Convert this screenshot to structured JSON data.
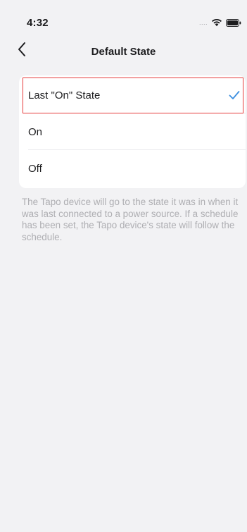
{
  "status_bar": {
    "time": "4:32",
    "signal_dots": "....",
    "icons": [
      "wifi-icon",
      "battery-icon"
    ]
  },
  "nav": {
    "back_icon": "chevron-left-icon",
    "title": "Default State"
  },
  "options": [
    {
      "label": "Last \"On\" State",
      "selected": true
    },
    {
      "label": "On",
      "selected": false
    },
    {
      "label": "Off",
      "selected": false
    }
  ],
  "description": "The Tapo device will go to the state it was in when it was last connected to a power source. If a schedule has been set, the Tapo device's state will follow the schedule.",
  "colors": {
    "background": "#f2f2f4",
    "card": "#ffffff",
    "accent_check": "#3d8fe0",
    "highlight_outline": "#e53b3b",
    "description_text": "#aeaeb2"
  }
}
